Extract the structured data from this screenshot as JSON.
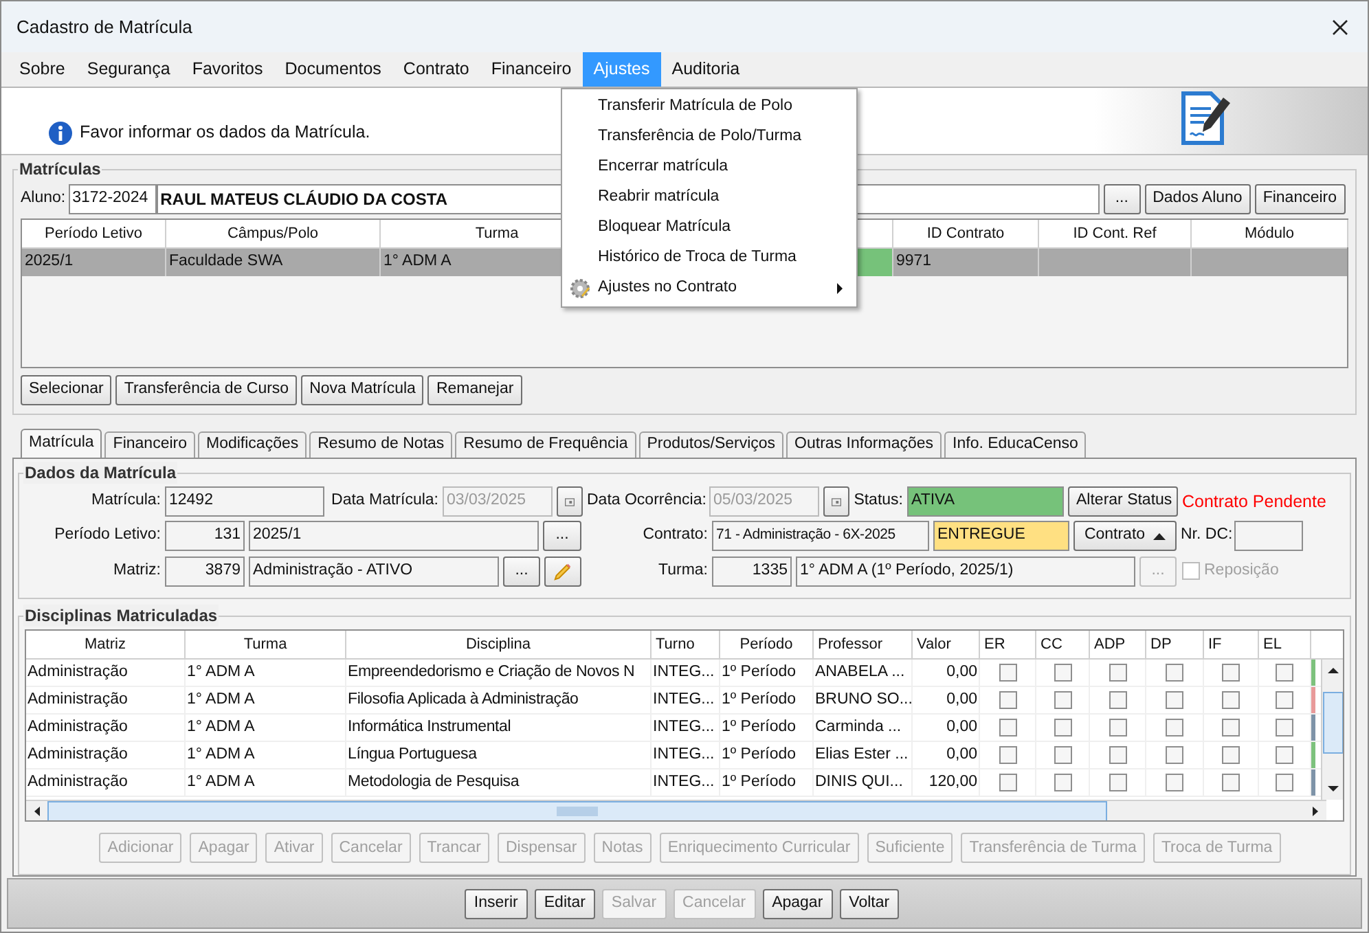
{
  "window": {
    "title": "Cadastro de Matrícula"
  },
  "menu_bar": [
    {
      "label": "Sobre",
      "selected": false
    },
    {
      "label": "Segurança",
      "selected": false
    },
    {
      "label": "Favoritos",
      "selected": false
    },
    {
      "label": "Documentos",
      "selected": false
    },
    {
      "label": "Contrato",
      "selected": false
    },
    {
      "label": "Financeiro",
      "selected": false
    },
    {
      "label": "Ajustes",
      "selected": true
    },
    {
      "label": "Auditoria",
      "selected": false
    }
  ],
  "open_menu": [
    {
      "label": "Transferir Matrícula de Polo",
      "kind": "item"
    },
    {
      "label": "Transferência de Polo/Turma",
      "kind": "item"
    },
    {
      "label": "Encerrar matrícula",
      "kind": "item"
    },
    {
      "label": "Reabrir matrícula",
      "kind": "item"
    },
    {
      "label": "Bloquear Matrícula",
      "kind": "item"
    },
    {
      "label": "Histórico de Troca de Turma",
      "kind": "item"
    },
    {
      "label": "Ajustes no Contrato",
      "kind": "submenu"
    }
  ],
  "banner": {
    "message": "Favor informar os dados da Matrícula."
  },
  "matriculas": {
    "title": "Matrículas",
    "aluno_label": "Aluno:",
    "aluno_code": "3172-2024",
    "aluno_name": "RAUL MATEUS CLÁUDIO DA COSTA",
    "browse_button": "...",
    "buttons": [
      "Dados Aluno",
      "Financeiro"
    ],
    "columns": [
      "Período Letivo",
      "Câmpus/Polo",
      "Turma",
      "ID Contrato",
      "ID Cont. Ref",
      "Módulo"
    ],
    "rows": [
      {
        "periodo": "2025/1",
        "campus": "Faculdade SWA",
        "turma": "1° ADM A",
        "id_contrato": "9971",
        "color": "#76c27a",
        "selected": true
      }
    ],
    "actions": [
      "Selecionar",
      "Transferência de Curso",
      "Nova Matrícula",
      "Remanejar"
    ]
  },
  "tabs": [
    {
      "label": "Matrícula",
      "selected": true
    },
    {
      "label": "Financeiro",
      "selected": false
    },
    {
      "label": "Modificações",
      "selected": false
    },
    {
      "label": "Resumo de Notas",
      "selected": false
    },
    {
      "label": "Resumo de Frequência",
      "selected": false
    },
    {
      "label": "Produtos/Serviços",
      "selected": false
    },
    {
      "label": "Outras Informações",
      "selected": false
    },
    {
      "label": "Info. EducaCenso",
      "selected": false
    }
  ],
  "dados": {
    "title": "Dados da Matrícula",
    "matricula": {
      "label": "Matrícula:",
      "value": "12492"
    },
    "data_matricula": {
      "label": "Data Matrícula:",
      "value": "03/03/2025",
      "disabled": true
    },
    "data_ocorrencia": {
      "label": "Data Ocorrência:",
      "value": "05/03/2025",
      "disabled": true
    },
    "status": {
      "label": "Status:",
      "value": "ATIVA",
      "color": "#76c27a"
    },
    "alterar_status": "Alterar Status",
    "alert": "Contrato Pendente",
    "periodo": {
      "label": "Período Letivo:",
      "code": "131",
      "value": "2025/1",
      "browse": "..."
    },
    "contrato": {
      "label": "Contrato:",
      "value": "71 - Administração - 6X-2025",
      "state": {
        "value": "ENTREGUE",
        "color": "#ffe082"
      },
      "button": "Contrato"
    },
    "nr_dc": {
      "label": "Nr. DC:"
    },
    "matriz": {
      "label": "Matriz:",
      "code": "3879",
      "value": "Administração - ATIVO",
      "browse": "..."
    },
    "turma": {
      "label": "Turma:",
      "code": "1335",
      "value": "1° ADM A (1º Período, 2025/1)",
      "browse": "...",
      "browse_disabled": true
    },
    "reposicao": {
      "label": "Reposição",
      "checked": false,
      "disabled": true
    }
  },
  "disciplinas": {
    "title": "Disciplinas Matriculadas",
    "columns": [
      "Matriz",
      "Turma",
      "Disciplina",
      "Turno",
      "Período",
      "Professor",
      "Valor",
      "ER",
      "CC",
      "ADP",
      "DP",
      "IF",
      "EL"
    ],
    "rows": [
      {
        "matriz": "Administração",
        "turma": "1° ADM A",
        "disciplina": "Empreendedorismo e Criação de Novos N",
        "turno": "INTEG...",
        "periodo": "1º Período",
        "professor": "ANABELA ...",
        "valor": "0,00",
        "color": "#7dc27d",
        "checks": [
          {
            "checked": false
          },
          {
            "checked": false
          },
          {
            "checked": false
          },
          {
            "checked": false
          },
          {
            "checked": false
          },
          {
            "checked": false
          }
        ]
      },
      {
        "matriz": "Administração",
        "turma": "1° ADM A",
        "disciplina": "Filosofia Aplicada à Administração",
        "turno": "INTEG...",
        "periodo": "1º Período",
        "professor": "BRUNO SO...",
        "valor": "0,00",
        "color": "#e89a9a",
        "checks": [
          {
            "checked": false
          },
          {
            "checked": false
          },
          {
            "checked": false
          },
          {
            "checked": false
          },
          {
            "checked": false
          },
          {
            "checked": false
          }
        ]
      },
      {
        "matriz": "Administração",
        "turma": "1° ADM A",
        "disciplina": "Informática Instrumental",
        "turno": "INTEG...",
        "periodo": "1º Período",
        "professor": "Carminda ...",
        "valor": "0,00",
        "color": "#7e93a8",
        "checks": [
          {
            "checked": false
          },
          {
            "checked": false
          },
          {
            "checked": false
          },
          {
            "checked": false
          },
          {
            "checked": false
          },
          {
            "checked": false
          }
        ]
      },
      {
        "matriz": "Administração",
        "turma": "1° ADM A",
        "disciplina": "Língua Portuguesa",
        "turno": "INTEG...",
        "periodo": "1º Período",
        "professor": "Elias Ester ...",
        "valor": "0,00",
        "color": "#7dc27d",
        "checks": [
          {
            "checked": false
          },
          {
            "checked": false
          },
          {
            "checked": false
          },
          {
            "checked": false
          },
          {
            "checked": false
          },
          {
            "checked": false
          }
        ]
      },
      {
        "matriz": "Administração",
        "turma": "1° ADM A",
        "disciplina": "Metodologia de Pesquisa",
        "turno": "INTEG...",
        "periodo": "1º Período",
        "professor": "DINIS QUI...",
        "valor": "120,00",
        "color": "#7e93a8",
        "checks": [
          {
            "checked": false
          },
          {
            "checked": false
          },
          {
            "checked": false
          },
          {
            "checked": false
          },
          {
            "checked": false
          },
          {
            "checked": false
          }
        ]
      }
    ],
    "actions": [
      {
        "label": "Adicionar",
        "disabled": true
      },
      {
        "label": "Apagar",
        "disabled": true
      },
      {
        "label": "Ativar",
        "disabled": true
      },
      {
        "label": "Cancelar",
        "disabled": true
      },
      {
        "label": "Trancar",
        "disabled": true
      },
      {
        "label": "Dispensar",
        "disabled": true
      },
      {
        "label": "Notas",
        "disabled": true
      },
      {
        "label": "Enriquecimento Curricular",
        "disabled": true
      },
      {
        "label": "Suficiente",
        "disabled": true
      },
      {
        "label": "Transferência de Turma",
        "disabled": true
      },
      {
        "label": "Troca de Turma",
        "disabled": true
      }
    ]
  },
  "footer_buttons": [
    {
      "label": "Inserir",
      "disabled": false
    },
    {
      "label": "Editar",
      "disabled": false
    },
    {
      "label": "Salvar",
      "disabled": true
    },
    {
      "label": "Cancelar",
      "disabled": true
    },
    {
      "label": "Apagar",
      "disabled": false
    },
    {
      "label": "Voltar",
      "disabled": false
    }
  ]
}
